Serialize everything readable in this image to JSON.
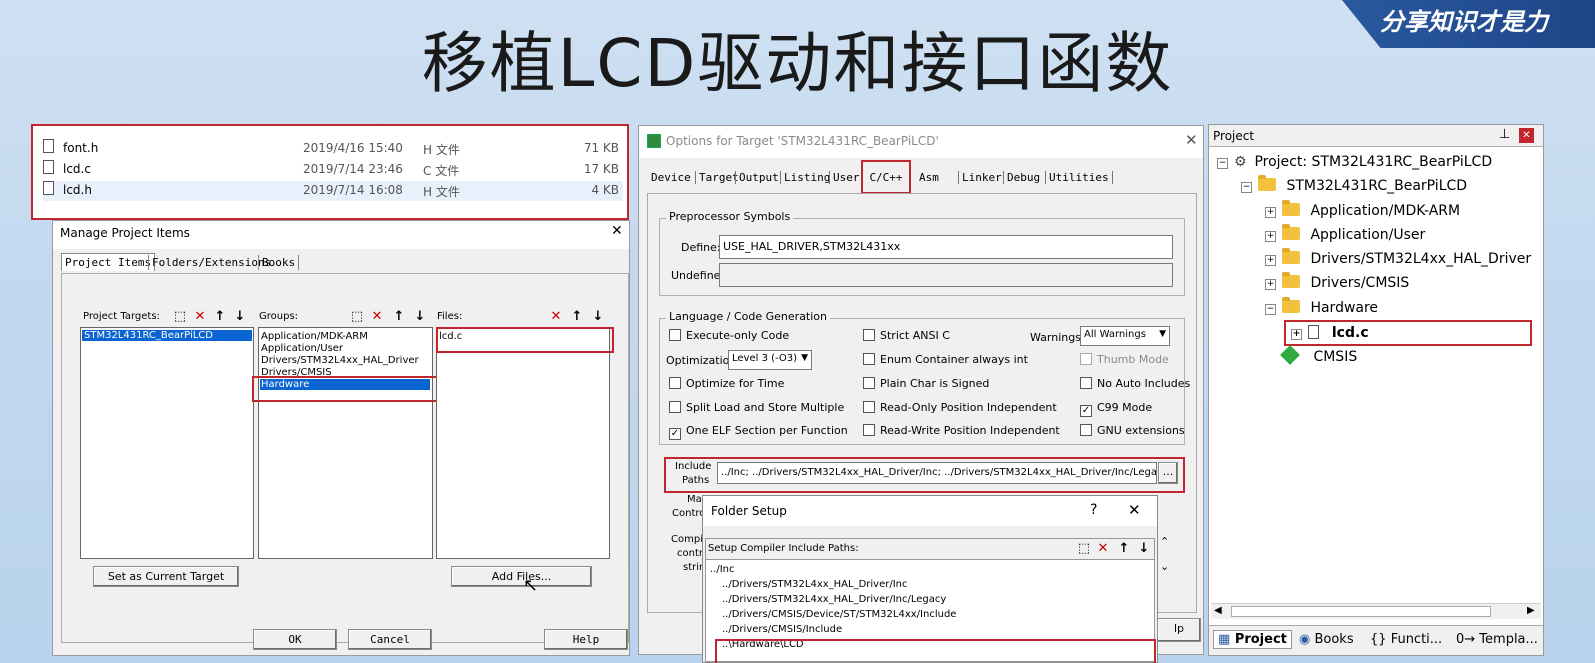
{
  "slide": {
    "title": "移植LCD驱动和接口函数",
    "brand": "分享知识才是力"
  },
  "explorer": {
    "files": [
      {
        "name": "font.h",
        "date": "2019/4/16 15:40",
        "type": "H 文件",
        "size": "71 KB"
      },
      {
        "name": "lcd.c",
        "date": "2019/7/14 23:46",
        "type": "C 文件",
        "size": "17 KB"
      },
      {
        "name": "lcd.h",
        "date": "2019/7/14 16:08",
        "type": "H 文件",
        "size": "4 KB"
      }
    ]
  },
  "manage": {
    "title": "Manage Project Items",
    "close": "✕",
    "tabs": [
      "Project Items",
      "Folders/Extensions",
      "Books"
    ],
    "targets_label": "Project Targets:",
    "groups_label": "Groups:",
    "files_label": "Files:",
    "targets": [
      "STM32L431RC_BearPiLCD"
    ],
    "groups": [
      "Application/MDK-ARM",
      "Application/User",
      "Drivers/STM32L4xx_HAL_Driver",
      "Drivers/CMSIS",
      "Hardware"
    ],
    "files": [
      "lcd.c"
    ],
    "set_current": "Set as Current Target",
    "add_files": "Add Files...",
    "ok": "OK",
    "cancel": "Cancel",
    "help": "Help"
  },
  "options": {
    "title": "Options for Target 'STM32L431RC_BearPiLCD'",
    "close": "✕",
    "tabs": [
      "Device",
      "Target",
      "Output",
      "Listing",
      "User",
      "C/C++",
      "Asm",
      "Linker",
      "Debug",
      "Utilities"
    ],
    "preproc_title": "Preprocessor Symbols",
    "define_label": "Define:",
    "define_value": "USE_HAL_DRIVER,STM32L431xx",
    "undefine_label": "Undefine:",
    "langgen_title": "Language / Code Generation",
    "execute_only": "Execute-only Code",
    "optimization_label": "Optimization:",
    "optimization_value": "Level 3 (-O3)",
    "optimize_time": "Optimize for Time",
    "split_load": "Split Load and Store Multiple",
    "one_elf": "One ELF Section per Function",
    "strict_ansi": "Strict ANSI C",
    "enum_container": "Enum Container always int",
    "plain_char": "Plain Char is Signed",
    "ro_pos": "Read-Only Position Independent",
    "rw_pos": "Read-Write Position Independent",
    "warnings_label": "Warnings:",
    "warnings_value": "All Warnings",
    "thumb_mode": "Thumb Mode",
    "no_auto": "No Auto Includes",
    "c99": "C99 Mode",
    "gnu_ext": "GNU extensions",
    "include_label_1": "Include",
    "include_label_2": "Paths",
    "include_value": "../Inc;    ../Drivers/STM32L4xx_HAL_Driver/Inc;    ../Drivers/STM32L4xx_HAL_Driver/Inc/Legacy",
    "browse": "...",
    "misc_1": "Ma",
    "misc_2": "Control",
    "compiler_1": "Compile",
    "compiler_2": "contro",
    "compiler_3": "strin",
    "help_fragment": "lp"
  },
  "folder_setup": {
    "title": "Folder Setup",
    "question": "?",
    "close": "✕",
    "label": "Setup Compiler Include Paths:",
    "paths": [
      "../Inc",
      "../Drivers/STM32L4xx_HAL_Driver/Inc",
      "../Drivers/STM32L4xx_HAL_Driver/Inc/Legacy",
      "../Drivers/CMSIS/Device/ST/STM32L4xx/Include",
      "../Drivers/CMSIS/Include",
      "..\\Hardware\\LCD"
    ]
  },
  "project": {
    "title": "Project",
    "pin": "⊥",
    "close": "✕",
    "root": "Project: STM32L431RC_BearPiLCD",
    "target": "STM32L431RC_BearPiLCD",
    "groups": [
      "Application/MDK-ARM",
      "Application/User",
      "Drivers/STM32L4xx_HAL_Driver",
      "Drivers/CMSIS",
      "Hardware"
    ],
    "file": "lcd.c",
    "cmsis": "CMSIS",
    "bottom_tabs": [
      "Project",
      "Books",
      "Functi...",
      "Templa..."
    ]
  }
}
